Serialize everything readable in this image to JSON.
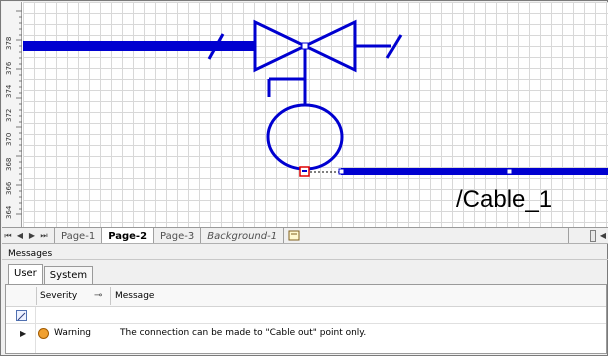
{
  "ruler": {
    "labels": [
      "378",
      "376",
      "374",
      "372",
      "370",
      "368",
      "366",
      "364"
    ]
  },
  "drawing": {
    "cable_label": "/Cable_1"
  },
  "page_tabs": {
    "nav": [
      "first-page",
      "previous-page",
      "next-page",
      "last-page"
    ],
    "tabs": [
      "Page-1",
      "Page-2",
      "Page-3",
      "Background-1"
    ],
    "active": "Page-2"
  },
  "messages": {
    "title": "Messages",
    "tabs": [
      "User",
      "System"
    ],
    "columns": {
      "severity": "Severity",
      "message": "Message"
    },
    "rows": [
      {
        "severity": "Warning",
        "message": "The connection can be made to \"Cable out\" point only."
      }
    ]
  },
  "colors": {
    "shape": "#0000d0",
    "grid": "#d8d8d8",
    "warning": "#f0a030",
    "selection": "#e00000"
  }
}
